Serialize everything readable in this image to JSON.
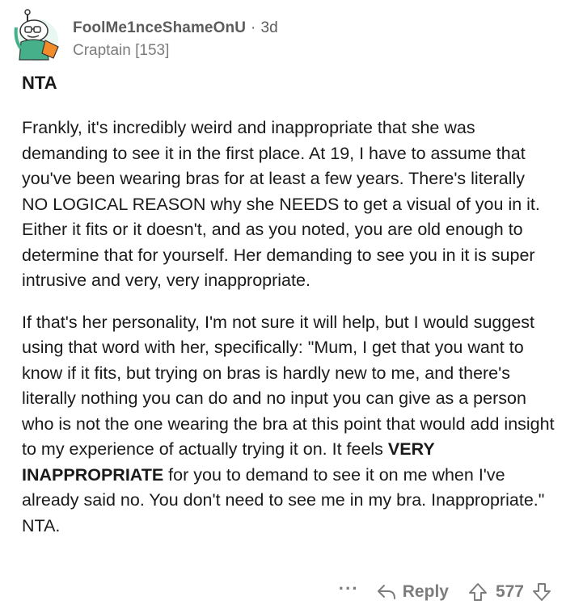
{
  "comment": {
    "username": "FoolMe1nceShameOnU",
    "separator": "·",
    "age": "3d",
    "flair": "Craptain [153]",
    "title": "NTA",
    "paragraph1": "Frankly, it's incredibly weird and inappropriate that she was demanding to see it in the first place. At 19, I have to assume that you've been wearing bras for at least a few years. There's literally NO LOGICAL REASON why she NEEDS to get a visual of you in it. Either it fits or it doesn't, and as you noted, you are old enough to determine that for yourself. Her demanding to see you in it is super intrusive and very, very inappropriate.",
    "paragraph2_before": "If that's her personality, I'm not sure it will help, but I would suggest using that word with her, specifically: \"Mum, I get that you want to know if it fits, but trying on bras is hardly new to me, and there's literally nothing you can do and no input you can give as a person who is not the one wearing the bra at this point that would add insight to my experience of actually trying it on. It feels ",
    "paragraph2_bold": "VERY INAPPROPRIATE",
    "paragraph2_after": " for you to demand to see it on me when I've already said no. You don't need to see me in my bra. Inappropriate.\" NTA."
  },
  "actions": {
    "more_label": "···",
    "reply_label": "Reply",
    "vote_count": "577",
    "reply_icon": "reply-arrow-icon",
    "upvote_icon": "upvote-arrow-icon",
    "downvote_icon": "downvote-arrow-icon"
  },
  "colors": {
    "text": "#1a1a1b",
    "meta": "#7c7c7c",
    "avatar_body": "#46b08a",
    "avatar_head": "#ffffff"
  }
}
